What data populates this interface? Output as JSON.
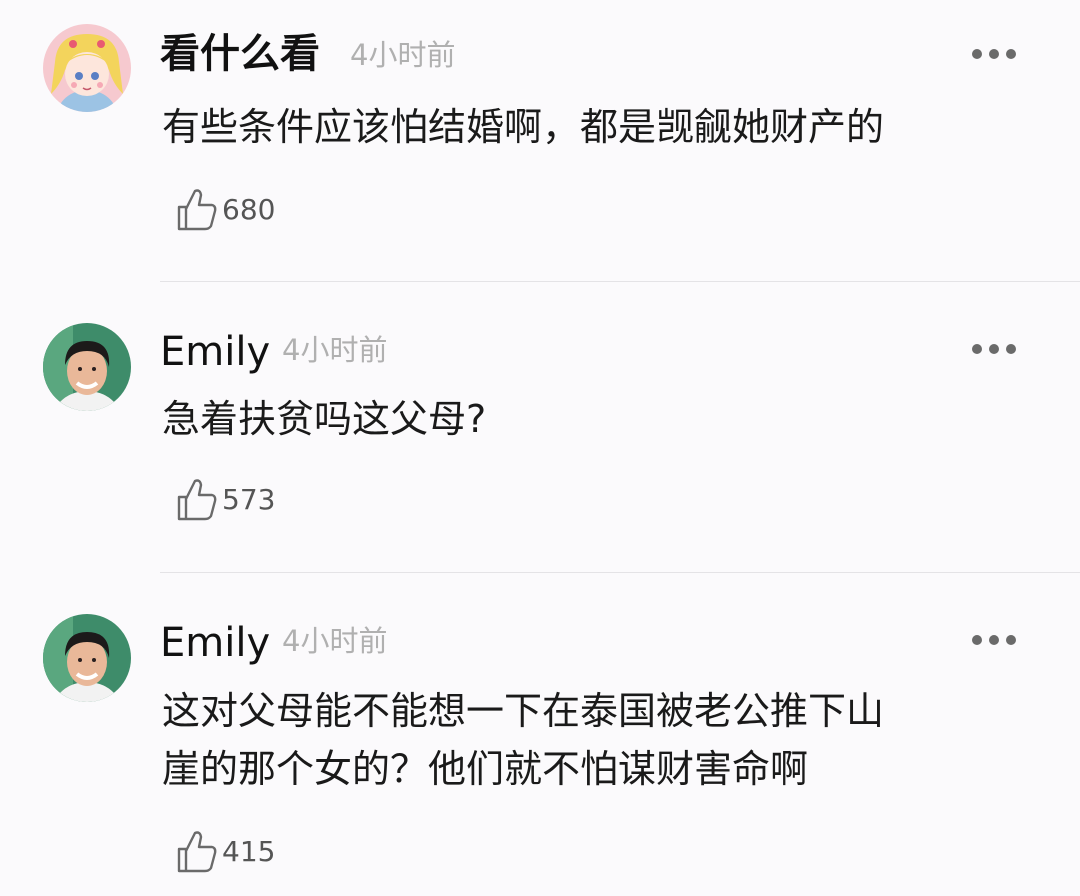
{
  "comments": [
    {
      "username": "看什么看",
      "time": "4小时前",
      "text_lines": [
        "有些条件应该怕结婚啊，都是觊觎她财产的"
      ],
      "likes": "680",
      "avatar_icon": "anime-girl-avatar-icon"
    },
    {
      "username": "Emily",
      "time": "4小时前",
      "text_lines": [
        "急着扶贫吗这父母?"
      ],
      "likes": "573",
      "avatar_icon": "man-portrait-avatar-icon"
    },
    {
      "username": "Emily",
      "time": "4小时前",
      "text_lines": [
        "这对父母能不能想一下在泰国被老公推下山",
        "崖的那个女的？他们就不怕谋财害命啊"
      ],
      "likes": "415",
      "avatar_icon": "man-portrait-avatar-icon"
    }
  ],
  "colors": {
    "background": "#fbfafc",
    "username": "#111111",
    "time": "#b0b0b0",
    "text": "#1a1a1a",
    "like_icon": "#6a6a6a",
    "divider": "#e4e3e6"
  }
}
